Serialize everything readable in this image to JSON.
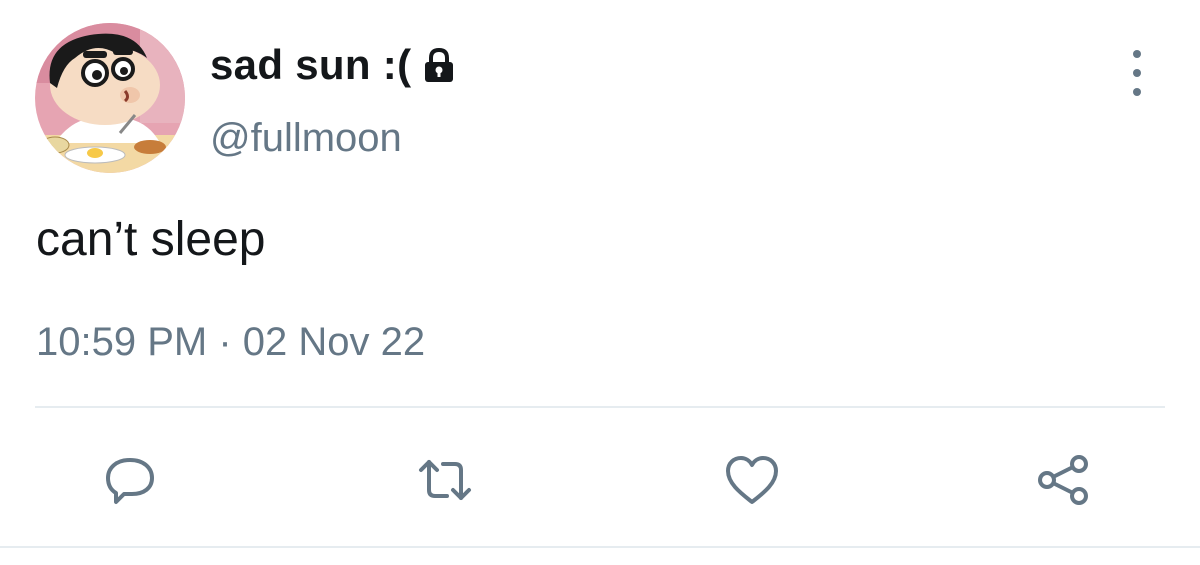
{
  "user": {
    "display_name": "sad sun :(",
    "handle": "@fullmoon",
    "protected": true,
    "avatar_description": "cartoon-boy-avatar"
  },
  "tweet": {
    "text": "can’t sleep",
    "time": "10:59 PM",
    "separator": "·",
    "date": "02 Nov 22"
  },
  "icons": {
    "lock": "lock-icon",
    "more": "more-vertical-icon",
    "reply": "reply-icon",
    "retweet": "retweet-icon",
    "like": "heart-icon",
    "share": "share-icon"
  },
  "colors": {
    "text": "#14171a",
    "secondary": "#657786",
    "divider": "#e6ecf0",
    "background": "#ffffff"
  }
}
